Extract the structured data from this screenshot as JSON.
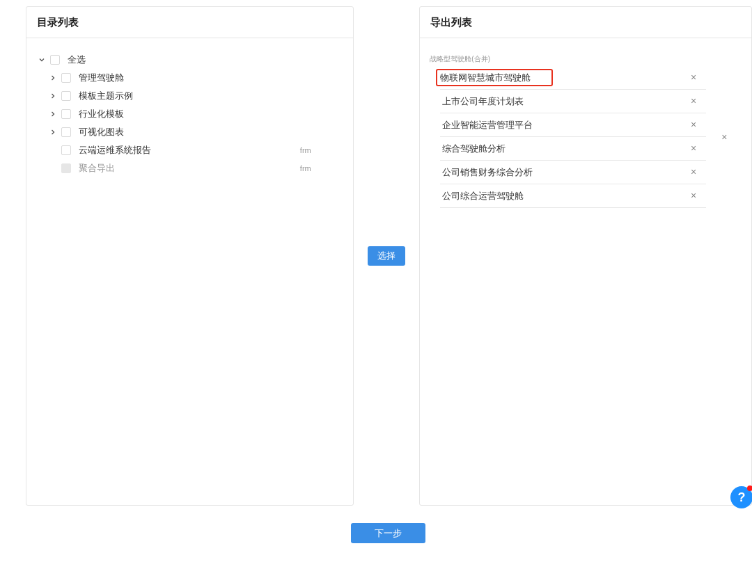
{
  "catalog": {
    "title": "目录列表",
    "tree": [
      {
        "label": "全选",
        "kind": "folder",
        "expanded": true,
        "checked": false,
        "disabled": false,
        "children": [
          {
            "label": "管理驾驶舱",
            "kind": "folder",
            "expanded": false,
            "checked": false,
            "disabled": false
          },
          {
            "label": "模板主题示例",
            "kind": "folder",
            "expanded": false,
            "checked": false,
            "disabled": false
          },
          {
            "label": "行业化模板",
            "kind": "folder",
            "expanded": false,
            "checked": false,
            "disabled": false
          },
          {
            "label": "可视化图表",
            "kind": "folder",
            "expanded": false,
            "checked": false,
            "disabled": false
          },
          {
            "label": "云端运维系统报告",
            "kind": "file",
            "tag": "frm",
            "checked": false,
            "disabled": false
          },
          {
            "label": "聚合导出",
            "kind": "file",
            "tag": "frm",
            "checked": false,
            "disabled": true
          }
        ]
      }
    ]
  },
  "select_button": "选择",
  "export": {
    "title": "导出列表",
    "groups": [
      {
        "label": "战略型驾驶舱(合并)",
        "remove": "×",
        "items": [
          {
            "label": "物联网智慧城市驾驶舱",
            "remove": "×",
            "highlighted": true
          },
          {
            "label": "上市公司年度计划表",
            "remove": "×",
            "highlighted": false
          },
          {
            "label": "企业智能运营管理平台",
            "remove": "×",
            "highlighted": false
          },
          {
            "label": "综合驾驶舱分析",
            "remove": "×",
            "highlighted": false
          },
          {
            "label": "公司销售财务综合分析",
            "remove": "×",
            "highlighted": false
          },
          {
            "label": "公司综合运营驾驶舱",
            "remove": "×",
            "highlighted": false
          }
        ]
      }
    ]
  },
  "next_button": "下一步",
  "help_button": {
    "label": "?",
    "notification": true
  }
}
